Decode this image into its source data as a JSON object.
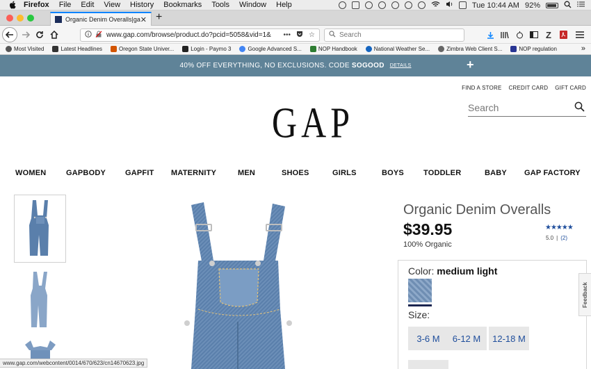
{
  "menubar": {
    "app": "Firefox",
    "items": [
      "File",
      "Edit",
      "View",
      "History",
      "Bookmarks",
      "Tools",
      "Window",
      "Help"
    ],
    "clock": "Tue 10:44 AM",
    "battery": "92%"
  },
  "browser": {
    "tab_title": "Organic Denim Overalls|gap",
    "url": "www.gap.com/browse/product.do?pcid=5058&vid=1&",
    "search_placeholder": "Search",
    "bookmarks": [
      {
        "label": "Most Visited",
        "color": "#555555"
      },
      {
        "label": "Latest Headlines",
        "color": "#333333"
      },
      {
        "label": "Oregon State Univer...",
        "color": "#d35400"
      },
      {
        "label": "Login - Paymo 3",
        "color": "#222222"
      },
      {
        "label": "Google Advanced S...",
        "color": "#4285f4"
      },
      {
        "label": "NOP Handbook",
        "color": "#2e7d32"
      },
      {
        "label": "National Weather Se...",
        "color": "#1565c0"
      },
      {
        "label": "Zimbra Web Client S...",
        "color": "#666666"
      },
      {
        "label": "NOP regulation",
        "color": "#283593"
      }
    ]
  },
  "promo": {
    "text": "40% OFF EVERYTHING, NO EXCLUSIONS. CODE",
    "code": "SOGOOD",
    "details": "DETAILS",
    "plus": "+"
  },
  "header": {
    "utility_links": [
      "FIND A STORE",
      "CREDIT CARD",
      "GIFT CARD"
    ],
    "logo": "GAP",
    "search_placeholder": "Search"
  },
  "categories": [
    "WOMEN",
    "GAPBODY",
    "GAPFIT",
    "MATERNITY",
    "MEN",
    "SHOES",
    "GIRLS",
    "BOYS",
    "TODDLER",
    "BABY",
    "GAP FACTORY"
  ],
  "product": {
    "title": "Organic Denim Overalls",
    "price": "$39.95",
    "subtitle": "100% Organic",
    "stars": "★★★★★",
    "rating": "5.0",
    "rating_sep": "|",
    "review_count": "(2)",
    "color_label": "Color:",
    "color_value": "medium light",
    "size_label": "Size:",
    "sizes": [
      "3-6 M",
      "6-12 M",
      "12-18 M"
    ]
  },
  "feedback": "Feedback",
  "status_url": "www.gap.com/webcontent/0014/670/623/cn14670623.jpg",
  "colors": {
    "promo_bg": "#5f8398",
    "link_blue": "#1f4e9c",
    "size_bg": "#e7e7e7",
    "denim": "#5a7fab"
  }
}
